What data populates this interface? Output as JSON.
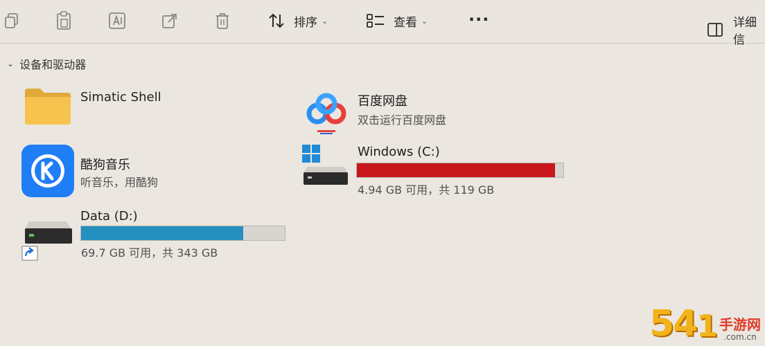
{
  "toolbar": {
    "sort_label": "排序",
    "view_label": "查看",
    "more_label": "···",
    "details_label": "详细信"
  },
  "section": {
    "title": "设备和驱动器"
  },
  "items": {
    "simatic": {
      "title": "Simatic Shell"
    },
    "baidu": {
      "title": "百度网盘",
      "subtitle": "双击运行百度网盘"
    },
    "kugou": {
      "title": "酷狗音乐",
      "subtitle": "听音乐，用酷狗"
    },
    "drive_c": {
      "title": "Windows (C:)",
      "usage": "4.94 GB 可用，共 119 GB",
      "used_fraction": 0.959,
      "bar_color": "#c8171d"
    },
    "drive_d": {
      "title": "Data (D:)",
      "usage": "69.7 GB 可用，共 343 GB",
      "used_fraction": 0.797,
      "bar_color": "#2590c0"
    }
  },
  "watermark": {
    "digits": "54",
    "digits2": "1",
    "cn": "手游网",
    "domain": ".com.cn"
  }
}
